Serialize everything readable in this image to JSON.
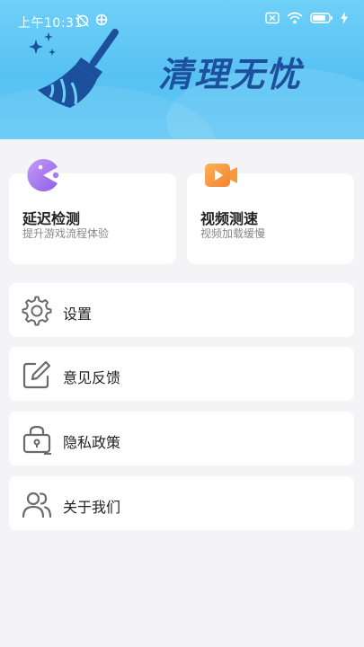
{
  "status_bar": {
    "time": "上午10:31"
  },
  "header": {
    "brand_title": "清理无忧"
  },
  "features": [
    {
      "title": "延迟检测",
      "subtitle": "提升游戏流程体验",
      "icon": "pacman-icon"
    },
    {
      "title": "视频测速",
      "subtitle": "视频加载缓慢",
      "icon": "video-play-icon"
    }
  ],
  "menu": [
    {
      "label": "设置",
      "icon": "gear-icon"
    },
    {
      "label": "意见反馈",
      "icon": "edit-icon"
    },
    {
      "label": "隐私政策",
      "icon": "lock-icon"
    },
    {
      "label": "关于我们",
      "icon": "users-icon"
    }
  ],
  "colors": {
    "header_bg": "#57c1f3",
    "brand_text": "#1c4f9c",
    "pacman_purple": "#a77cf0",
    "video_orange": "#f89a3c",
    "icon_gray": "#6b6b6b"
  }
}
